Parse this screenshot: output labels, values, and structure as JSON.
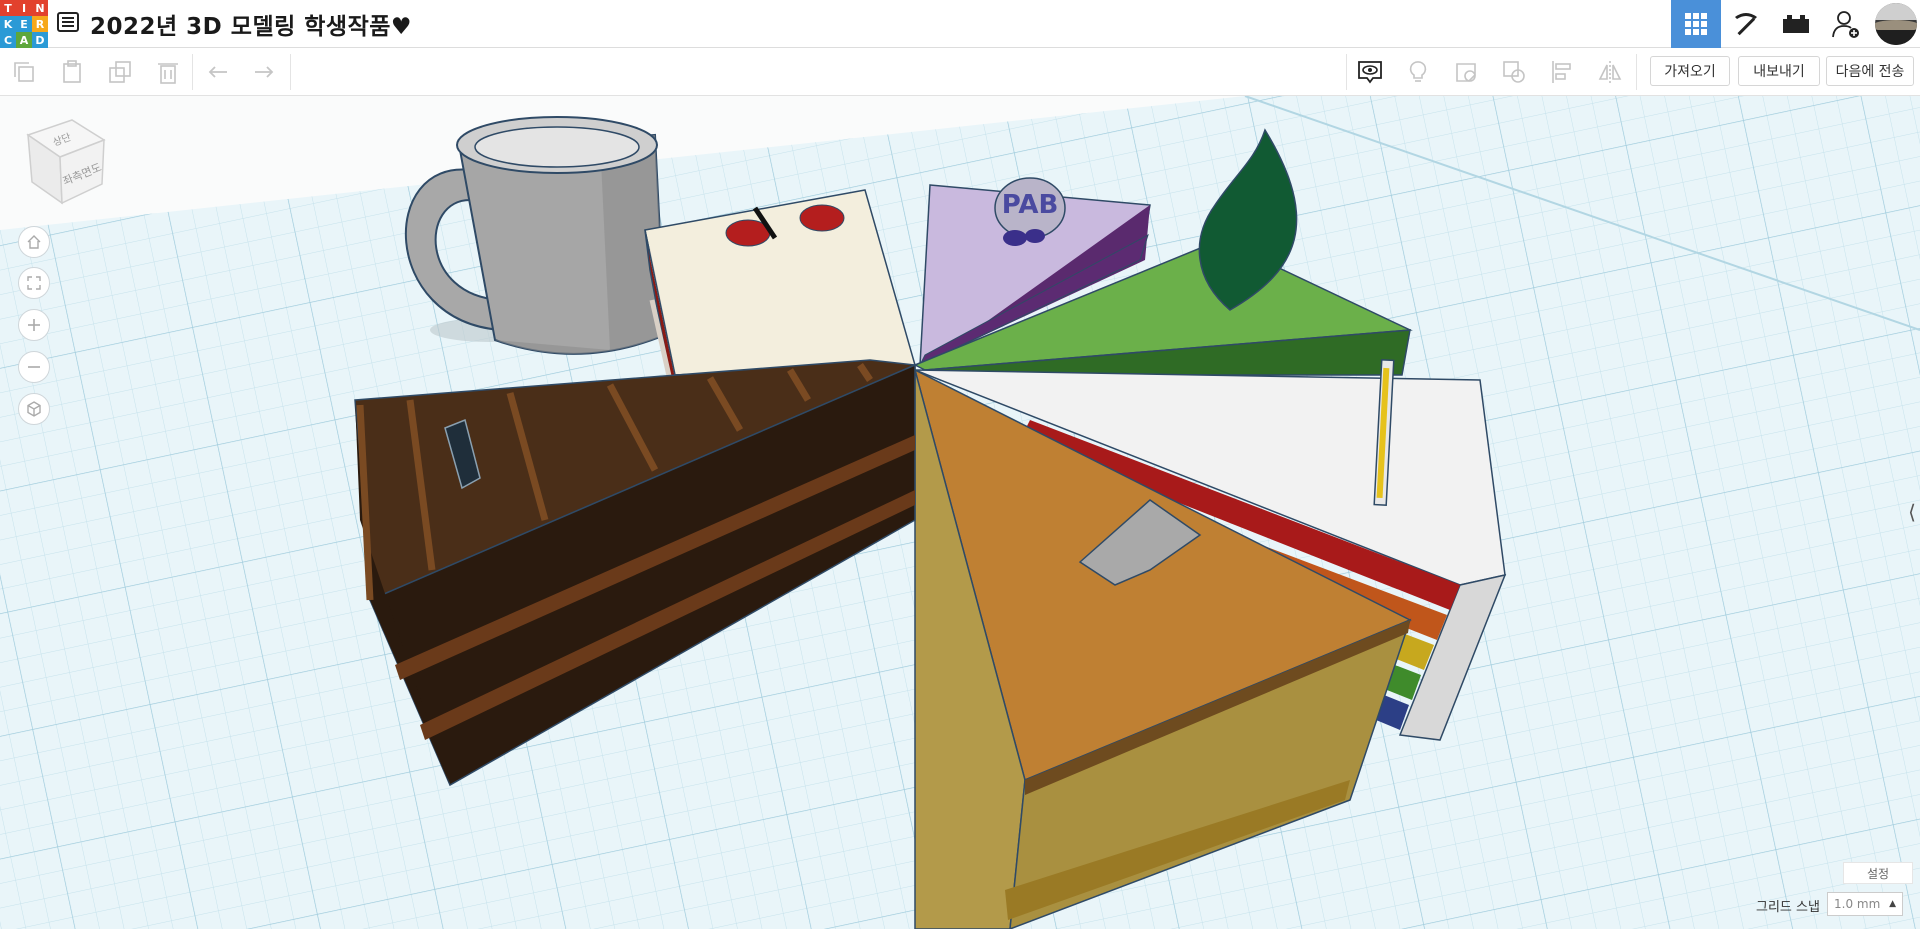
{
  "app": {
    "logo_letters": [
      "T",
      "I",
      "N",
      "K",
      "E",
      "R",
      "C",
      "A",
      "D"
    ],
    "logo_colors": [
      "#e2412d",
      "#e2412d",
      "#e2412d",
      "#2b9ad6",
      "#2b9ad6",
      "#f6a81b",
      "#2b9ad6",
      "#5ea73c",
      "#2b9ad6"
    ],
    "accent": "#4a90d9"
  },
  "header": {
    "title": "2022년 3D 모델링 학생작품♥",
    "icons": [
      "design-list-icon",
      "3d-grid-view-icon",
      "pickaxe-icon",
      "bricks-icon",
      "add-user-icon",
      "profile-avatar"
    ]
  },
  "toolbar": {
    "edit_icons": [
      "copy-icon",
      "paste-icon",
      "duplicate-icon",
      "delete-icon",
      "undo-icon",
      "redo-icon"
    ],
    "shape_icons": [
      "notes-visibility-icon",
      "lightbulb-icon",
      "note-icon",
      "group-icon",
      "align-icon",
      "mirror-icon"
    ],
    "import_label": "가져오기",
    "export_label": "내보내기",
    "send_label": "다음에 전송"
  },
  "viewcube": {
    "face_top": "상단",
    "face_front": "좌측면도"
  },
  "scene": {
    "grid_color": "#b9dce8",
    "background": "#e8f4f8"
  },
  "footer": {
    "settings_label": "설정",
    "snap_label": "그리드 스냅",
    "snap_value": "1.0 mm"
  }
}
